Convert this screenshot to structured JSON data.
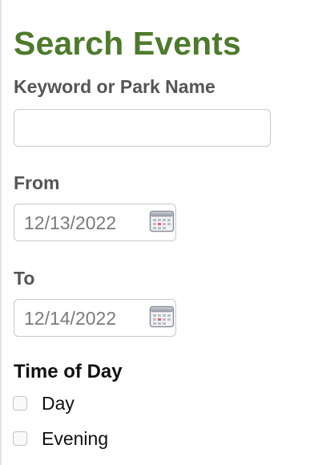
{
  "page": {
    "title": "Search Events"
  },
  "keyword": {
    "label": "Keyword or Park Name",
    "value": "",
    "placeholder": ""
  },
  "from": {
    "label": "From",
    "value": "12/13/2022",
    "icon": "calendar-icon"
  },
  "to": {
    "label": "To",
    "value": "12/14/2022",
    "icon": "calendar-icon"
  },
  "time_of_day": {
    "label": "Time of Day",
    "options": [
      {
        "label": "Day",
        "checked": false
      },
      {
        "label": "Evening",
        "checked": false
      }
    ]
  },
  "colors": {
    "title": "#4e7a2c",
    "label": "#555555",
    "date_text": "#7a7a7a"
  }
}
